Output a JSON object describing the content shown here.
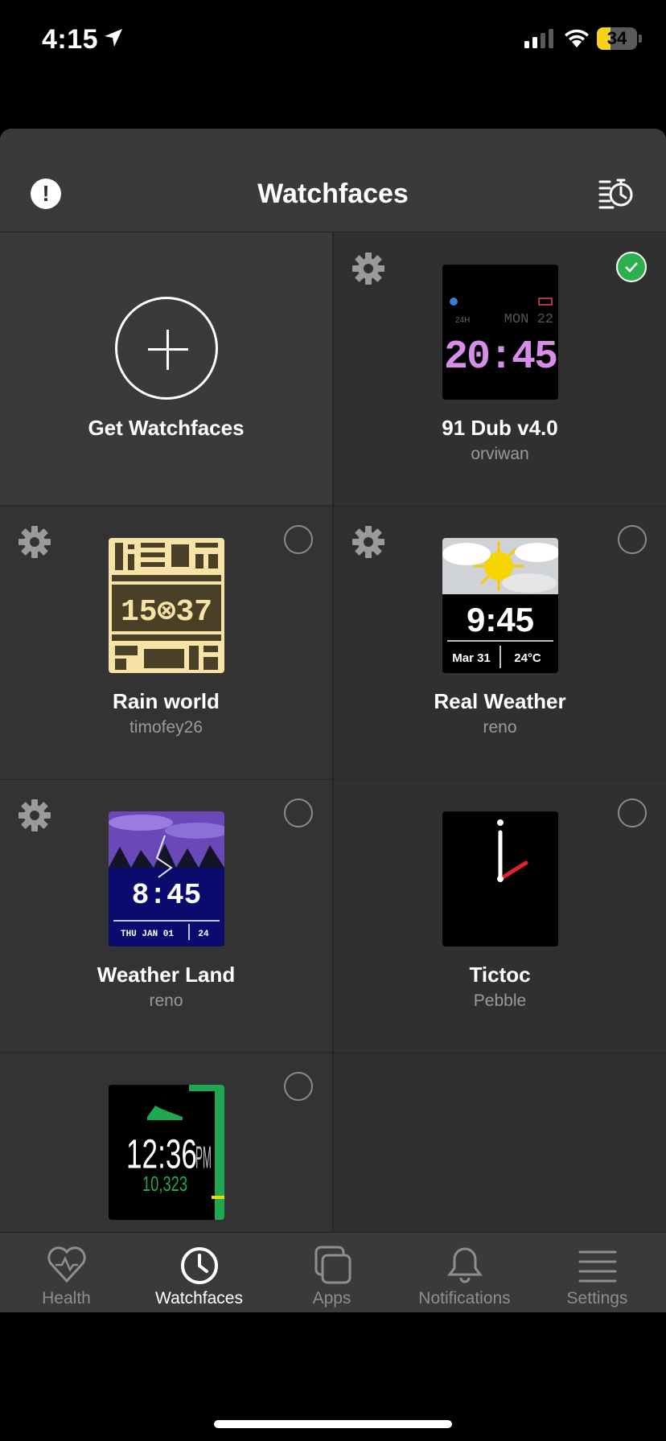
{
  "status_bar": {
    "time": "4:15",
    "battery": "34"
  },
  "header": {
    "title": "Watchfaces",
    "alert_icon": "exclamation-icon",
    "sort_icon": "list-clock-icon"
  },
  "get_watchfaces": {
    "label": "Get Watchfaces"
  },
  "watchfaces": [
    {
      "name": "91 Dub v4.0",
      "author": "orviwan",
      "selected": true,
      "has_settings": true,
      "preview": {
        "top_left": "24H",
        "top_right": "MON 22",
        "time": "20:45"
      }
    },
    {
      "name": "Rain world",
      "author": "timofey26",
      "selected": false,
      "has_settings": true,
      "preview": {
        "time": "15⊗37"
      }
    },
    {
      "name": "Real Weather",
      "author": "reno",
      "selected": false,
      "has_settings": true,
      "preview": {
        "time": "9:45",
        "date": "Mar 31",
        "temp": "24°C"
      }
    },
    {
      "name": "Weather Land",
      "author": "reno",
      "selected": false,
      "has_settings": true,
      "preview": {
        "time": "8:45",
        "date": "THU JAN 01",
        "day": "24"
      }
    },
    {
      "name": "Tictoc",
      "author": "Pebble",
      "selected": false,
      "has_settings": false,
      "preview": {}
    },
    {
      "name": "",
      "author": "",
      "selected": false,
      "has_settings": false,
      "preview": {
        "time": "12:36",
        "ampm": "PM",
        "steps": "10,323"
      }
    }
  ],
  "tabs": [
    {
      "label": "Health",
      "icon": "heart-icon",
      "active": false
    },
    {
      "label": "Watchfaces",
      "icon": "clock-icon",
      "active": true
    },
    {
      "label": "Apps",
      "icon": "apps-icon",
      "active": false
    },
    {
      "label": "Notifications",
      "icon": "bell-icon",
      "active": false
    },
    {
      "label": "Settings",
      "icon": "menu-icon",
      "active": false
    }
  ],
  "colors": {
    "accent_selected": "#2cb04d",
    "sheet_bg": "#2f2f2f",
    "header_bg": "#3a3a3a"
  }
}
